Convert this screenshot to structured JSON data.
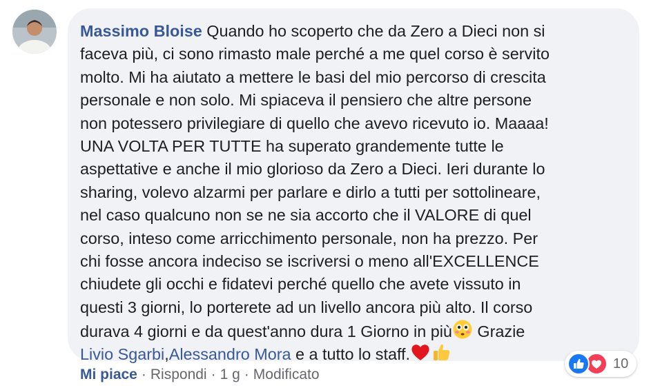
{
  "comment": {
    "author": "Massimo Bloise",
    "lines": [
      "Quando ho scoperto che da Zero a Dieci non si",
      "faceva più, ci sono rimasto male perché a me quel corso è servito",
      "molto. Mi ha aiutato a mettere le basi del mio percorso di crescita",
      "personale e non solo. Mi spiaceva il pensiero che altre persone",
      "non potessero privilegiare di quello che avevo ricevuto io. Maaaa!",
      "UNA VOLTA PER TUTTE ha superato grandemente tutte le",
      "aspettative e anche il mio glorioso da Zero a Dieci. Ieri durante lo",
      "sharing, volevo alzarmi per parlare e dirlo a tutti per sottolineare,",
      "nel caso qualcuno non se ne sia accorto che il VALORE di quel",
      "corso, inteso come arricchimento personale, non ha prezzo. Per",
      "chi fosse ancora indeciso se iscriversi o meno all'EXCELLENCE",
      "chiudete gli occhi e fidatevi perché quello che avete vissuto in",
      "questi 3 giorni, lo porterete ad un livello ancora più alto. Il corso",
      "durava 4 giorni e da quest'anno dura 1 Giorno in più"
    ],
    "line14_tail": "Grazie",
    "mention1": "Livio Sgarbi",
    "comma": ",",
    "mention2": "Alessandro Mora",
    "closing": "e a tutto lo staff."
  },
  "icons": {
    "avatar": "profile-photo",
    "flushed": "flushed-face-emoji",
    "heart": "red-heart-emoji",
    "thumb": "thumbs-up-emoji",
    "like_reaction": "like-reaction-icon",
    "love_reaction": "love-reaction-icon"
  },
  "colors": {
    "link": "#385898",
    "text": "#1c1e21",
    "meta": "#65676b",
    "bubble": "#f0f2f5",
    "like_blue": "#1877f2",
    "love_red": "#f33e58"
  },
  "reactions": {
    "count": "10"
  },
  "actions": {
    "like": "Mi piace",
    "reply": "Rispondi",
    "time": "1 g",
    "edited": "Modificato",
    "separator": "·"
  }
}
